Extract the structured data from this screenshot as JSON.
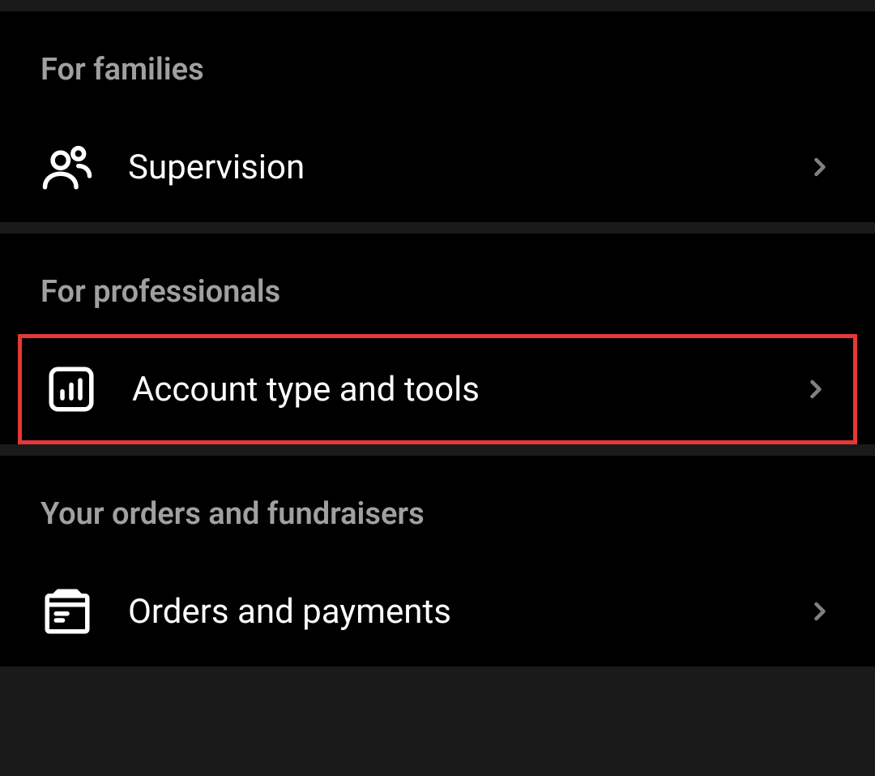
{
  "sections": [
    {
      "header": "For families",
      "items": [
        {
          "label": "Supervision",
          "icon": "supervision-icon",
          "highlighted": false
        }
      ]
    },
    {
      "header": "For professionals",
      "items": [
        {
          "label": "Account type and tools",
          "icon": "chart-icon",
          "highlighted": true
        }
      ]
    },
    {
      "header": "Your orders and fundraisers",
      "items": [
        {
          "label": "Orders and payments",
          "icon": "box-icon",
          "highlighted": false
        }
      ]
    }
  ]
}
